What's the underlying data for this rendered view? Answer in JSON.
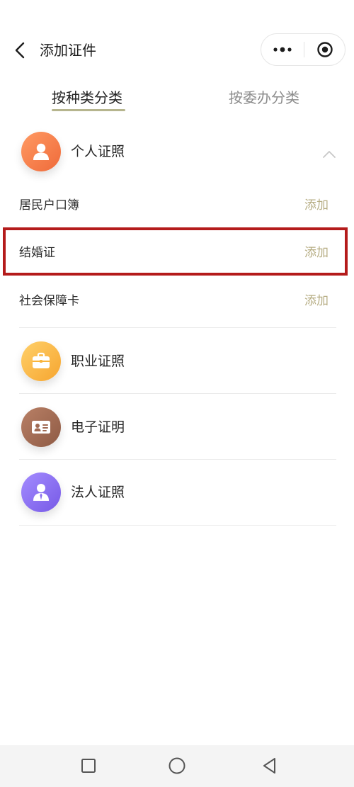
{
  "header": {
    "title": "添加证件",
    "back_icon": "back-arrow-icon",
    "more_icon": "more-dots-icon",
    "close_icon": "target-circle-icon"
  },
  "tabs": [
    {
      "label": "按种类分类",
      "active": true
    },
    {
      "label": "按委办分类",
      "active": false
    }
  ],
  "categories": [
    {
      "label": "个人证照",
      "icon": "person-icon",
      "color": "#f47d45",
      "expanded": true,
      "items": [
        {
          "label": "居民户口簿",
          "action": "添加"
        },
        {
          "label": "结婚证",
          "action": "添加",
          "highlighted": true
        },
        {
          "label": "社会保障卡",
          "action": "添加"
        }
      ]
    },
    {
      "label": "职业证照",
      "icon": "briefcase-icon",
      "color": "#f9b43b"
    },
    {
      "label": "电子证明",
      "icon": "id-card-icon",
      "color": "#a06a53"
    },
    {
      "label": "法人证照",
      "icon": "corporate-person-icon",
      "color": "#8b6ef0"
    }
  ],
  "accent_colors": {
    "tab_underline": "#b6b58e",
    "add_text": "#b6ad83",
    "highlight_border": "#b41b1b"
  },
  "system_nav": {
    "recent_icon": "square-icon",
    "home_icon": "circle-icon",
    "back_icon": "triangle-back-icon"
  }
}
